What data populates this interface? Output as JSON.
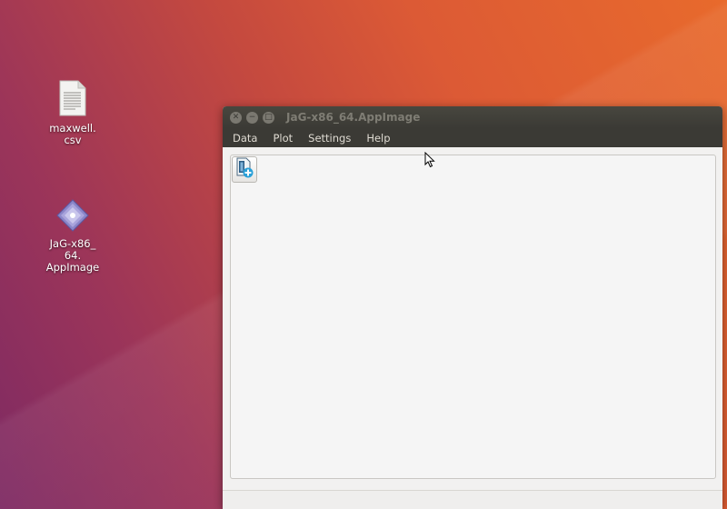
{
  "desktop": {
    "icons": [
      {
        "name": "csv-file",
        "label": "maxwell.\ncsv",
        "icon": "text-document-icon"
      },
      {
        "name": "appimage-file",
        "label": "JaG-x86_\n64.\nAppImage",
        "icon": "appimage-icon"
      }
    ]
  },
  "window": {
    "title": "JaG-x86_64.AppImage",
    "controls": [
      "close",
      "minimize",
      "maximize"
    ],
    "menu": [
      "Data",
      "Plot",
      "Settings",
      "Help"
    ],
    "toolbar": {
      "add_data_icon": "add-file-icon"
    }
  },
  "colors": {
    "titlebar": "#3b3a35",
    "window_bg": "#f2f1f0",
    "accent_plus": "#2aa0d8"
  }
}
